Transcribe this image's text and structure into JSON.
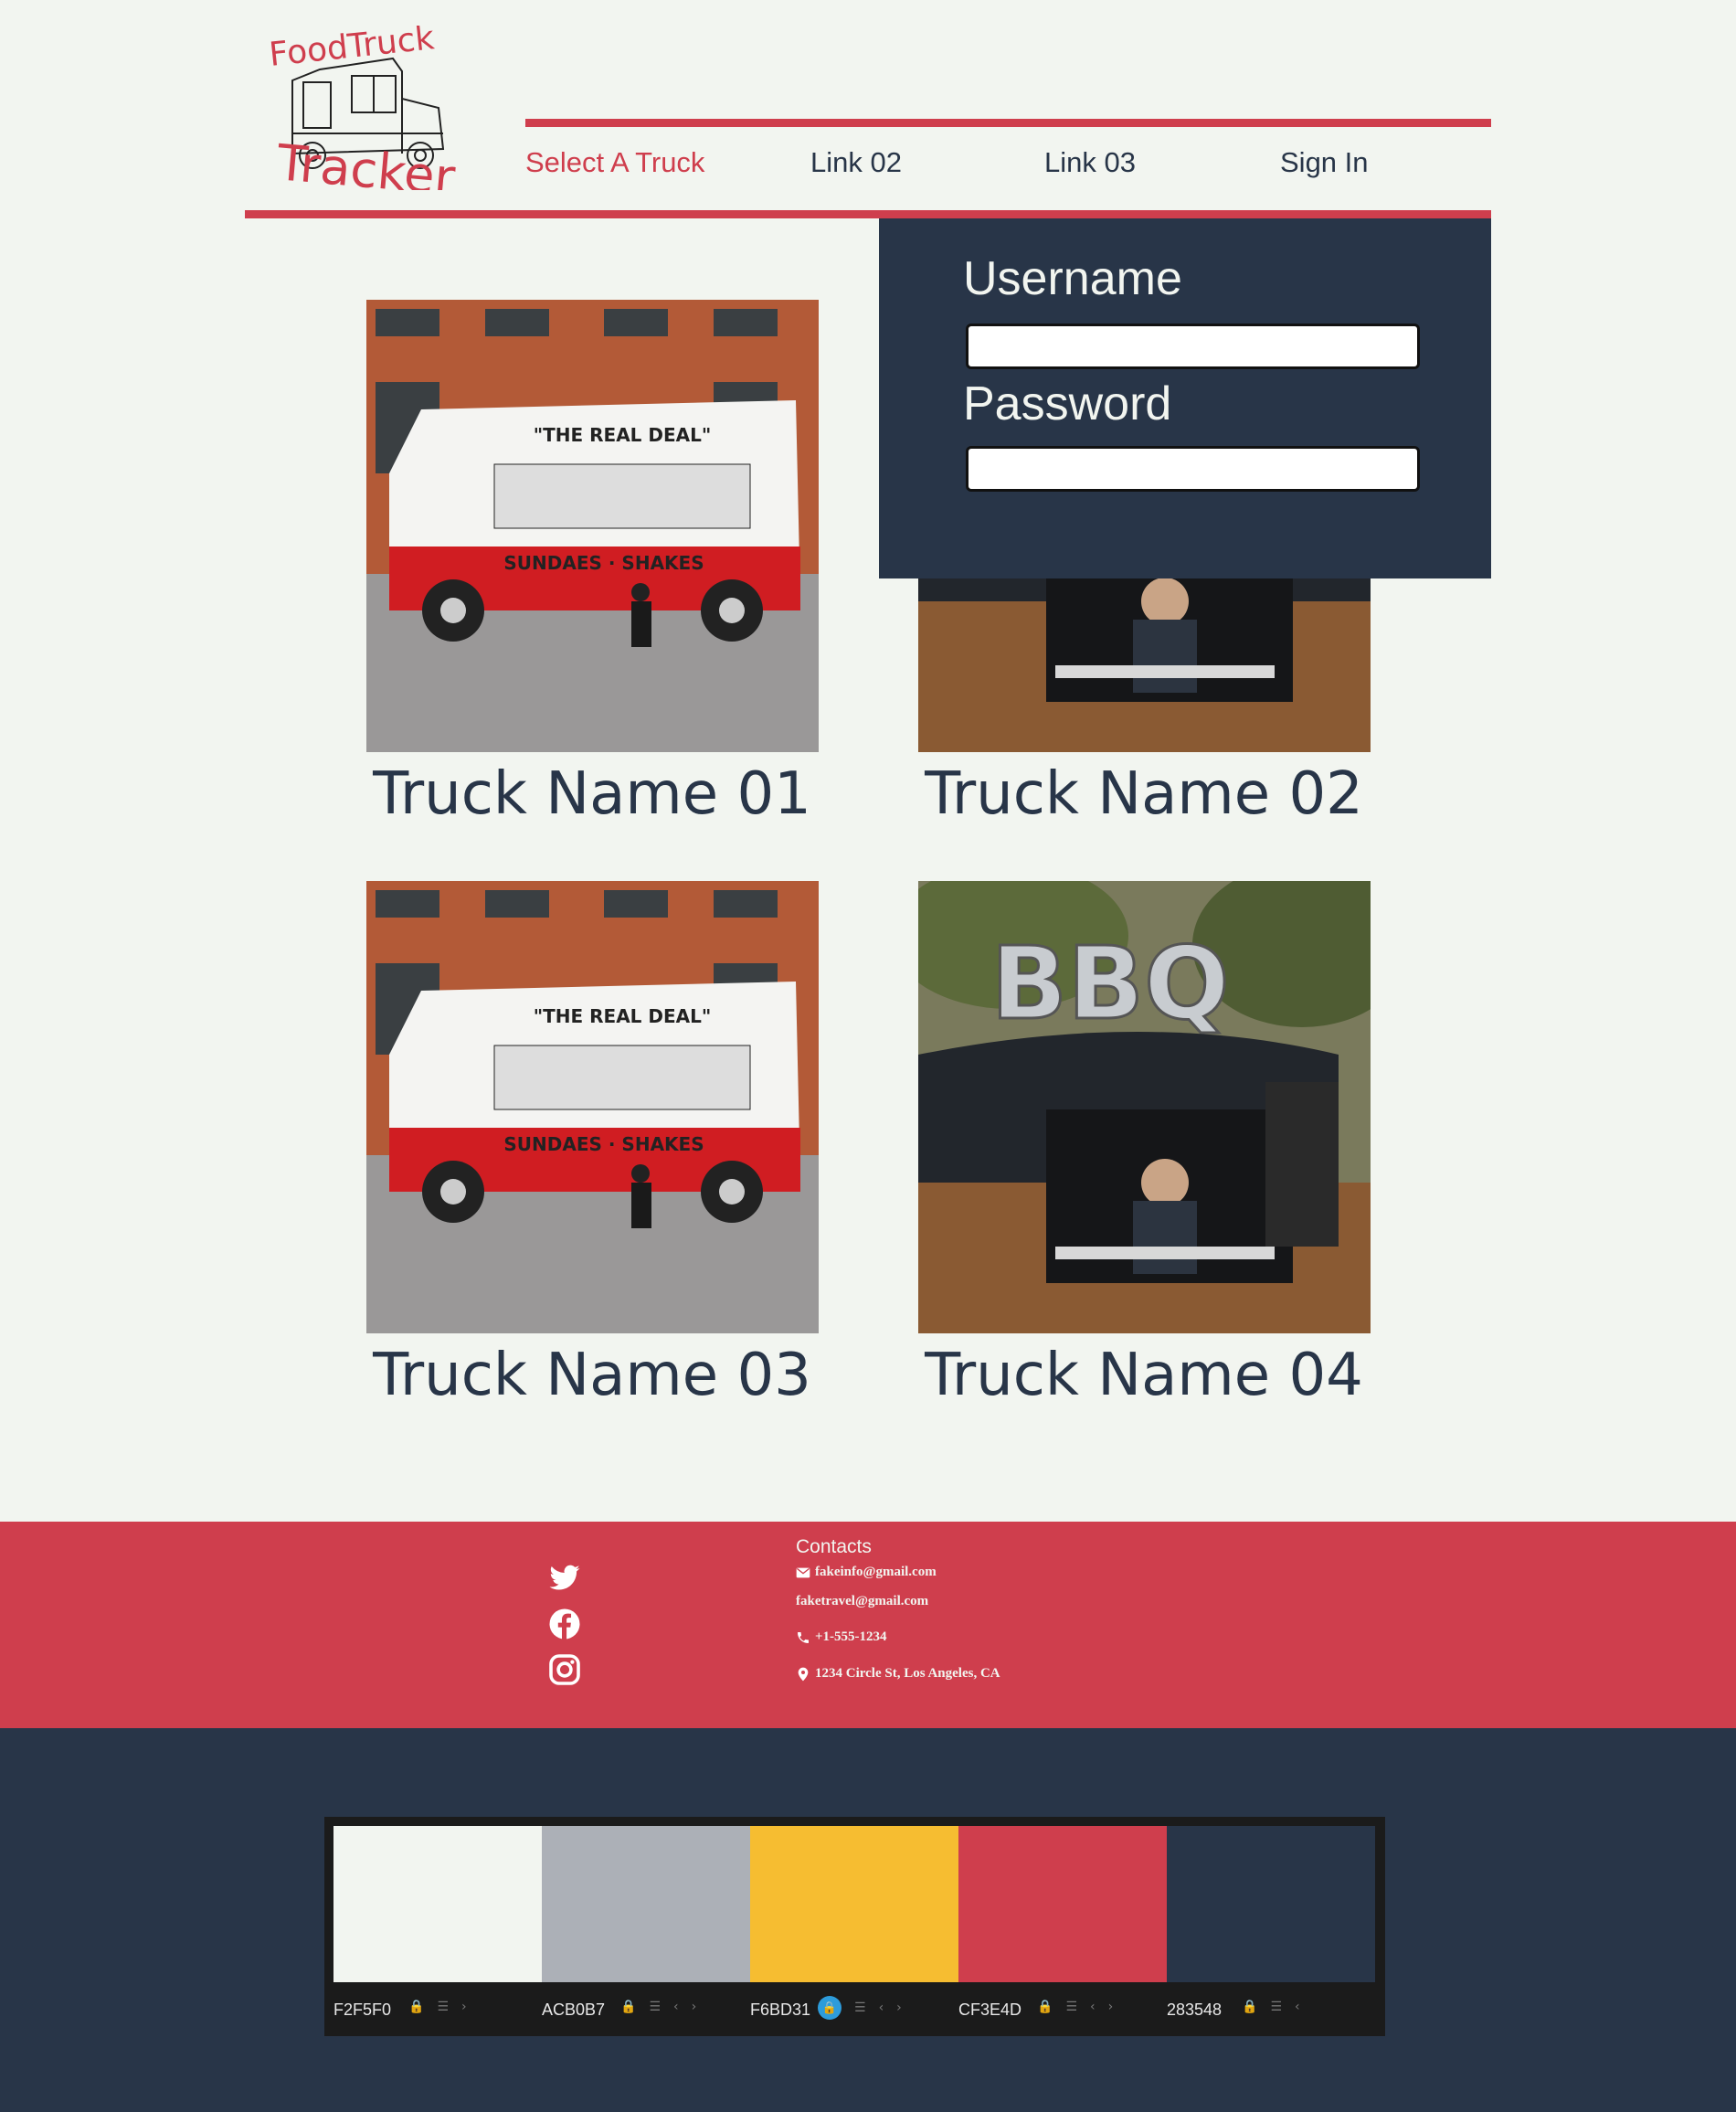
{
  "logo": {
    "line1": "FoodTruck",
    "line2": "Tracker",
    "icon": "food-truck-icon"
  },
  "nav": {
    "links": [
      {
        "label": "Select A Truck",
        "active": true
      },
      {
        "label": "Link 02",
        "active": false
      },
      {
        "label": "Link 03",
        "active": false
      },
      {
        "label": "Sign In",
        "active": false
      }
    ]
  },
  "login": {
    "username_label": "Username",
    "username_value": "",
    "password_label": "Password",
    "password_value": ""
  },
  "trucks": [
    {
      "name": "Truck Name 01",
      "image": "ice-cream-truck-photo"
    },
    {
      "name": "Truck Name 02",
      "image": "bbq-truck-photo"
    },
    {
      "name": "Truck Name 03",
      "image": "ice-cream-truck-photo"
    },
    {
      "name": "Truck Name 04",
      "image": "bbq-truck-photo"
    }
  ],
  "footer": {
    "social": [
      "twitter-icon",
      "facebook-icon",
      "instagram-icon"
    ],
    "contacts_title": "Contacts",
    "contacts": [
      {
        "icon": "envelope-icon",
        "text": "fakeinfo@gmail.com"
      },
      {
        "icon": "",
        "text": "faketravel@gmail.com"
      },
      {
        "icon": "phone-icon",
        "text": "+1-555-1234"
      },
      {
        "icon": "map-pin-icon",
        "text": "1234 Circle St, Los Angeles, CA"
      }
    ]
  },
  "palette": {
    "swatches": [
      {
        "hex": "#F2F5F0",
        "label": "F2F5F0",
        "locked": false
      },
      {
        "hex": "#ACB0B7",
        "label": "ACB0B7",
        "locked": false
      },
      {
        "hex": "#F6BD31",
        "label": "F6BD31",
        "locked": true
      },
      {
        "hex": "#CF3E4D",
        "label": "CF3E4D",
        "locked": false
      },
      {
        "hex": "#283548",
        "label": "283548",
        "locked": false
      }
    ]
  },
  "colors": {
    "background": "#F2F5F0",
    "accent": "#CF3E4D",
    "navy": "#283548"
  }
}
